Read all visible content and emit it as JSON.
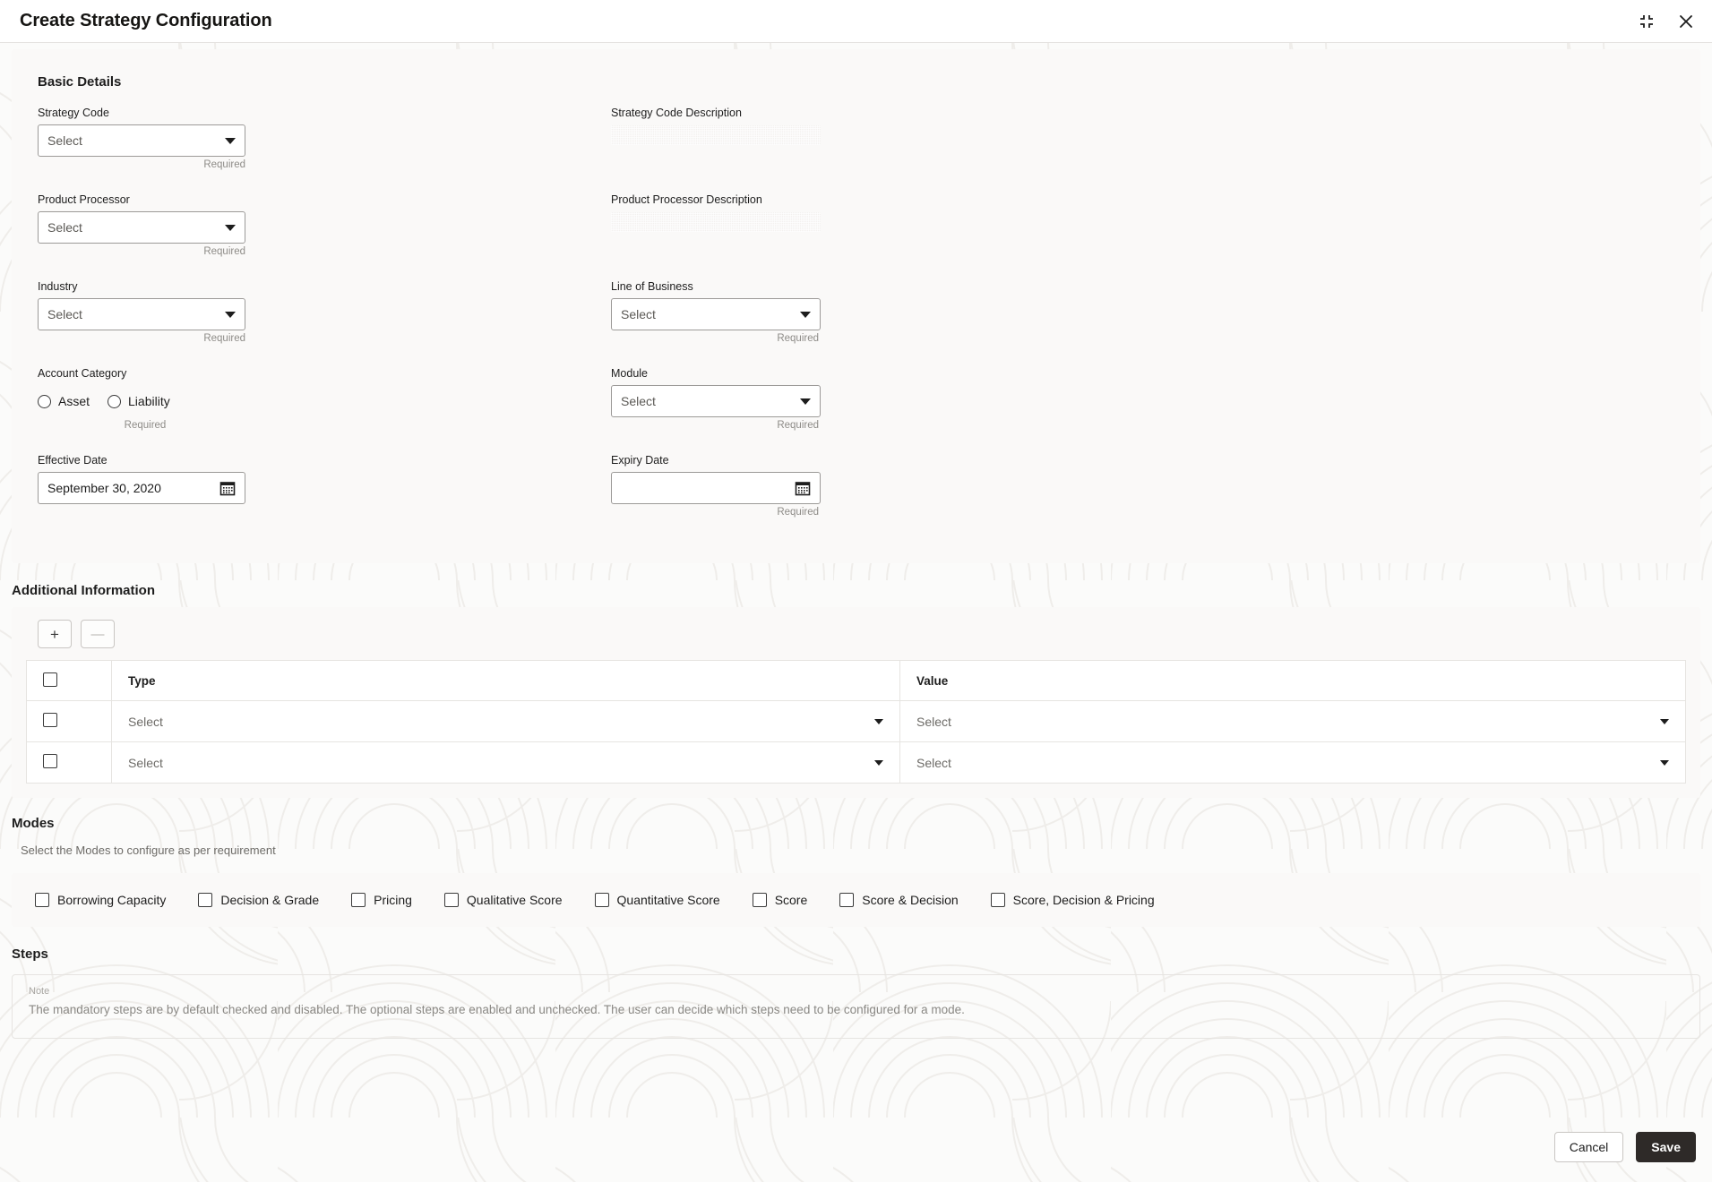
{
  "window": {
    "title": "Create Strategy Configuration",
    "minimize_icon": "collapse-corners-icon",
    "close_icon": "close-icon"
  },
  "basic_details": {
    "heading": "Basic Details",
    "strategy_code": {
      "label": "Strategy Code",
      "placeholder": "Select",
      "value": "",
      "helper": "Required"
    },
    "strategy_code_description": {
      "label": "Strategy Code Description",
      "value": ""
    },
    "product_processor": {
      "label": "Product Processor",
      "placeholder": "Select",
      "value": "",
      "helper": "Required"
    },
    "product_processor_description": {
      "label": "Product Processor Description",
      "value": ""
    },
    "industry": {
      "label": "Industry",
      "placeholder": "Select",
      "value": "",
      "helper": "Required"
    },
    "line_of_business": {
      "label": "Line of Business",
      "placeholder": "Select",
      "value": "",
      "helper": "Required"
    },
    "account_category": {
      "label": "Account Category",
      "helper": "Required",
      "options": [
        {
          "label": "Asset",
          "selected": false
        },
        {
          "label": "Liability",
          "selected": false
        }
      ]
    },
    "module": {
      "label": "Module",
      "placeholder": "Select",
      "value": "",
      "helper": "Required"
    },
    "effective_date": {
      "label": "Effective Date",
      "value": "September 30, 2020",
      "icon": "calendar-icon"
    },
    "expiry_date": {
      "label": "Expiry Date",
      "value": "",
      "helper": "Required",
      "icon": "calendar-icon"
    }
  },
  "additional_information": {
    "heading": "Additional Information",
    "add_label": "+",
    "remove_label": "—",
    "columns": [
      "Type",
      "Value"
    ],
    "rows": [
      {
        "type": "Select",
        "value": "Select",
        "checked": false
      },
      {
        "type": "Select",
        "value": "Select",
        "checked": false
      }
    ],
    "header_checked": false
  },
  "modes": {
    "heading": "Modes",
    "subtitle": "Select the Modes to configure as per requirement",
    "items": [
      {
        "label": "Borrowing Capacity",
        "checked": false
      },
      {
        "label": "Decision & Grade",
        "checked": false
      },
      {
        "label": "Pricing",
        "checked": false
      },
      {
        "label": "Qualitative Score",
        "checked": false
      },
      {
        "label": "Quantitative Score",
        "checked": false
      },
      {
        "label": "Score",
        "checked": false
      },
      {
        "label": "Score & Decision",
        "checked": false
      },
      {
        "label": "Score, Decision & Pricing",
        "checked": false
      }
    ]
  },
  "steps": {
    "heading": "Steps",
    "note_kicker": "Note",
    "note_text": "The mandatory steps are by default checked and disabled. The optional steps are enabled and unchecked. The user can decide which steps need to be configured for a mode."
  },
  "footer": {
    "cancel_label": "Cancel",
    "save_label": "Save"
  },
  "colors": {
    "save_button": "#2e2a28",
    "page_background": "#fbfbfa",
    "panel_background": "#faf9f8",
    "border": "#e6e4e1"
  }
}
